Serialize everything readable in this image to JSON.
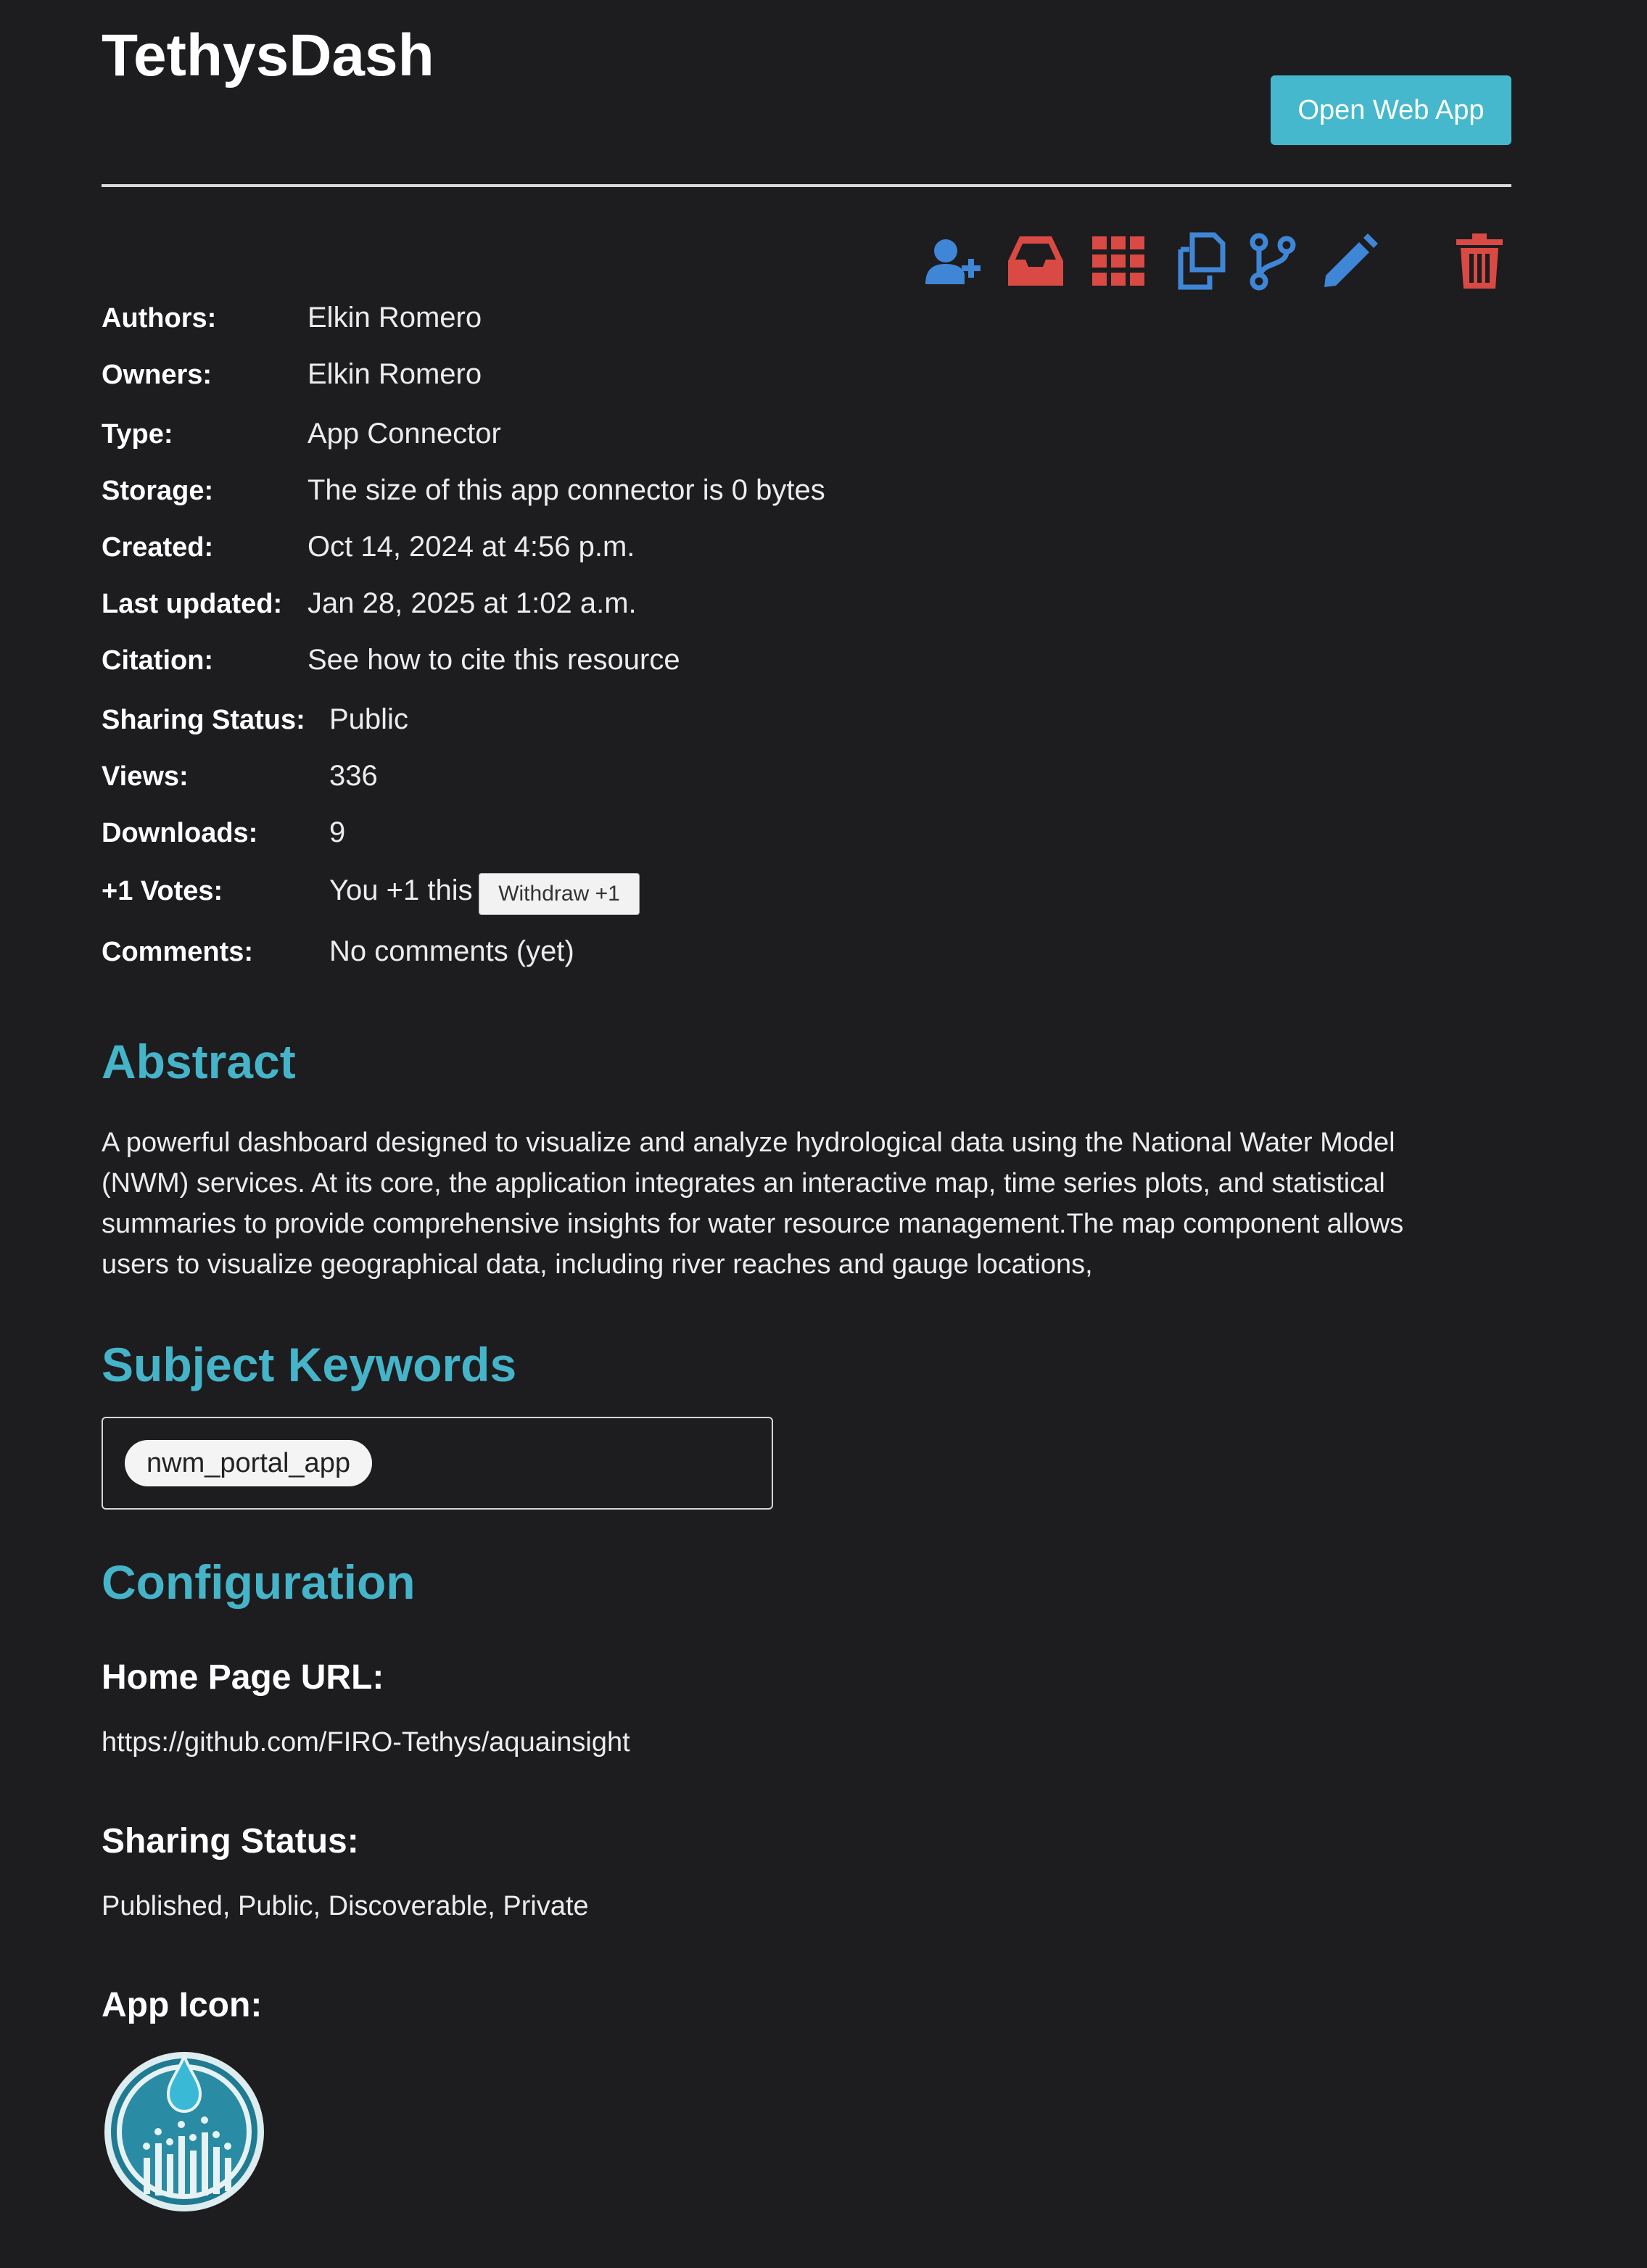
{
  "header": {
    "title": "TethysDash",
    "open_button": "Open Web App"
  },
  "toolbar": {
    "icons": [
      "add-user-icon",
      "inbox-icon",
      "grid-icon",
      "copy-icon",
      "fork-icon",
      "edit-icon",
      "trash-icon"
    ],
    "colors": {
      "blue": "#3f86d6",
      "red": "#d84a43"
    }
  },
  "meta": {
    "authors_label": "Authors:",
    "authors_value": "Elkin Romero",
    "owners_label": "Owners:",
    "owners_value": "Elkin Romero",
    "type_label": "Type:",
    "type_value": "App Connector",
    "storage_label": "Storage:",
    "storage_value": "The size of this app connector is 0 bytes",
    "created_label": "Created:",
    "created_value": "Oct 14, 2024 at 4:56 p.m.",
    "updated_label": "Last updated:",
    "updated_value": "Jan 28, 2025 at 1:02 a.m.",
    "citation_label": "Citation:",
    "citation_value": "See how to cite this resource",
    "sharing_label": "Sharing Status:",
    "sharing_value": "Public",
    "views_label": "Views:",
    "views_value": "336",
    "downloads_label": "Downloads:",
    "downloads_value": "9",
    "votes_label": "+1 Votes:",
    "votes_value": "You +1 this",
    "withdraw_button": "Withdraw +1",
    "comments_label": "Comments:",
    "comments_value": "No comments (yet)"
  },
  "abstract": {
    "heading": "Abstract",
    "text": "A powerful dashboard designed to visualize and analyze hydrological data using the National Water Model (NWM) services. At its core, the application integrates an interactive map, time series plots, and statistical summaries to provide comprehensive insights for water resource management.The map component allows users to visualize geographical data, including river reaches and gauge locations,"
  },
  "keywords": {
    "heading": "Subject Keywords",
    "items": [
      "nwm_portal_app"
    ]
  },
  "configuration": {
    "heading": "Configuration",
    "home_label": "Home Page URL:",
    "home_url": "https://github.com/FIRO-Tethys/aquainsight",
    "sharing_label": "Sharing Status:",
    "sharing_value": "Published, Public, Discoverable, Private",
    "icon_label": "App Icon:"
  },
  "colors": {
    "background": "#1d1c1f",
    "accent": "#45b8cd",
    "link": "#4fb8cf"
  }
}
